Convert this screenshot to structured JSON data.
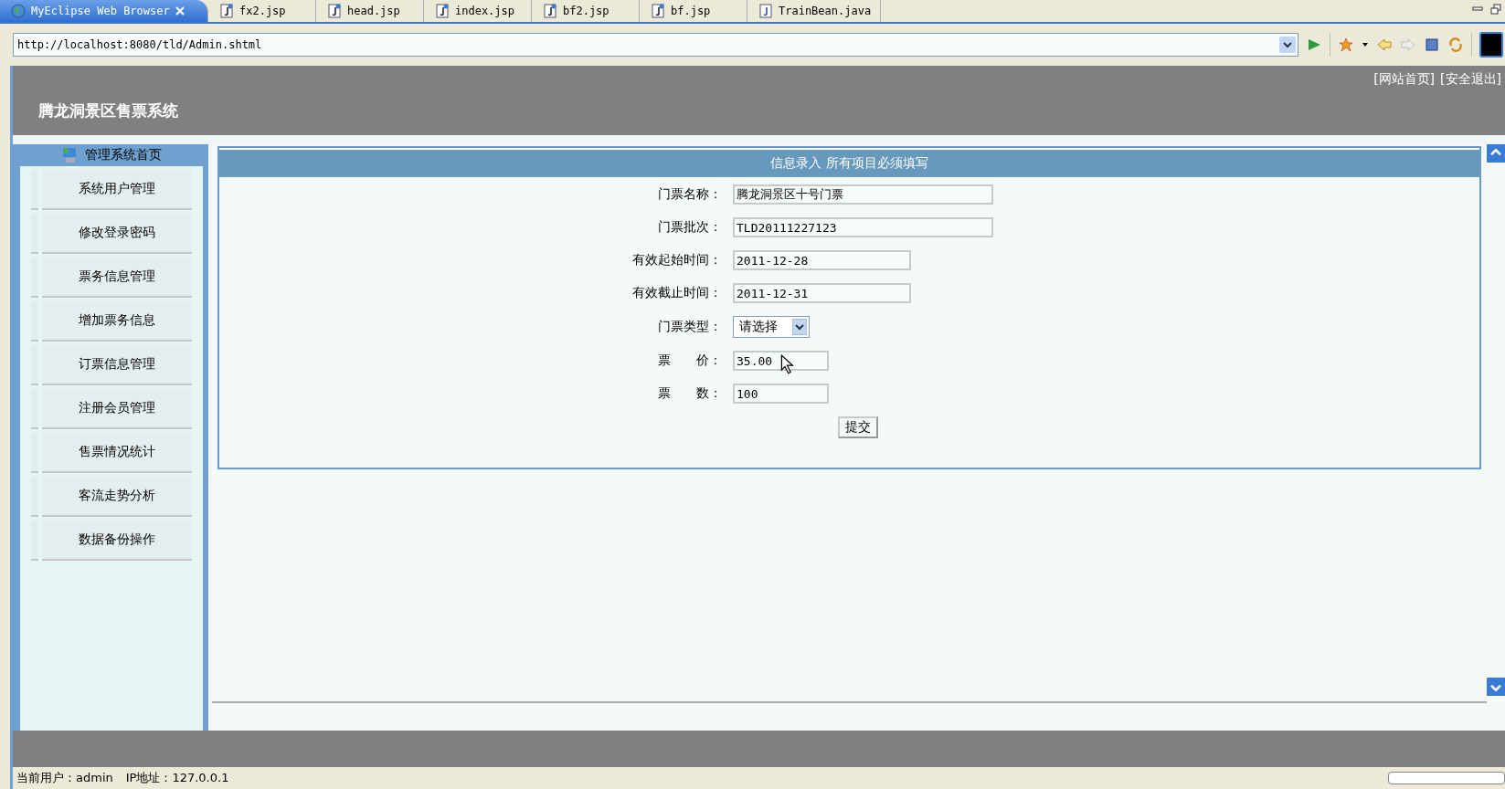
{
  "tabs": [
    {
      "label": "MyEclipse Web Browser",
      "kind": "browser",
      "selected": true
    },
    {
      "label": "fx2.jsp",
      "kind": "jsp",
      "selected": false
    },
    {
      "label": "head.jsp",
      "kind": "jsp",
      "selected": false
    },
    {
      "label": "index.jsp",
      "kind": "jsp",
      "selected": false
    },
    {
      "label": "bf2.jsp",
      "kind": "jsp",
      "selected": false
    },
    {
      "label": "bf.jsp",
      "kind": "jsp",
      "selected": false
    },
    {
      "label": "TrainBean.java",
      "kind": "java",
      "selected": false
    }
  ],
  "address": {
    "url": "http://localhost:8080/tld/Admin.shtml"
  },
  "header": {
    "title": "腾龙洞景区售票系统",
    "links": [
      "[网站首页]",
      "[安全退出]"
    ]
  },
  "sidebar": {
    "heading": "管理系统首页",
    "items": [
      "系统用户管理",
      "修改登录密码",
      "票务信息管理",
      "增加票务信息",
      "订票信息管理",
      "注册会员管理",
      "售票情况统计",
      "客流走势分析",
      "数据备份操作"
    ]
  },
  "form": {
    "title": "信息录入 所有项目必须填写",
    "fields": [
      {
        "label": "门票名称：",
        "value": "腾龙洞景区十号门票",
        "kind": "text"
      },
      {
        "label": "门票批次：",
        "value": "TLD20111227123",
        "kind": "text"
      },
      {
        "label": "有效起始时间：",
        "value": "2011-12-28",
        "kind": "text"
      },
      {
        "label": "有效截止时间：",
        "value": "2011-12-31",
        "kind": "text"
      },
      {
        "label": "门票类型：",
        "value": "请选择",
        "kind": "select"
      },
      {
        "label": "票　　价：",
        "value": "35.00",
        "kind": "text"
      },
      {
        "label": "票　　数：",
        "value": "100",
        "kind": "text"
      }
    ],
    "submit": "提交"
  },
  "status": [
    "当前用户：admin",
    "IP地址：127.0.0.1"
  ]
}
